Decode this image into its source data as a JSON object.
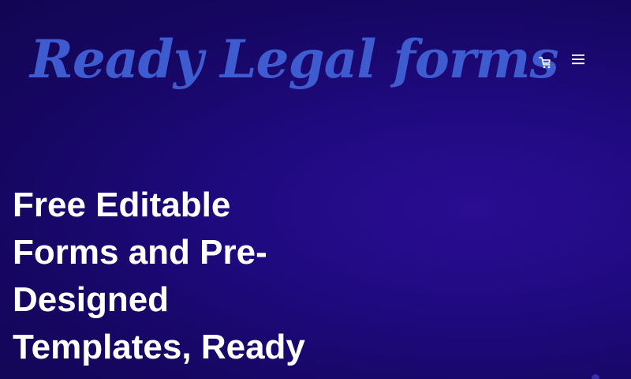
{
  "header": {
    "logo_text": "Ready Legal forms",
    "cart_icon": "shopping-cart-icon",
    "menu_icon": "hamburger-menu-icon"
  },
  "hero": {
    "title_lines": [
      "Free Editable",
      "Forms and Pre-",
      "Designed",
      "Templates, Ready"
    ]
  },
  "colors": {
    "background": "#170766",
    "logo": "#3f5bd0",
    "hero_text": "#ffffff"
  }
}
